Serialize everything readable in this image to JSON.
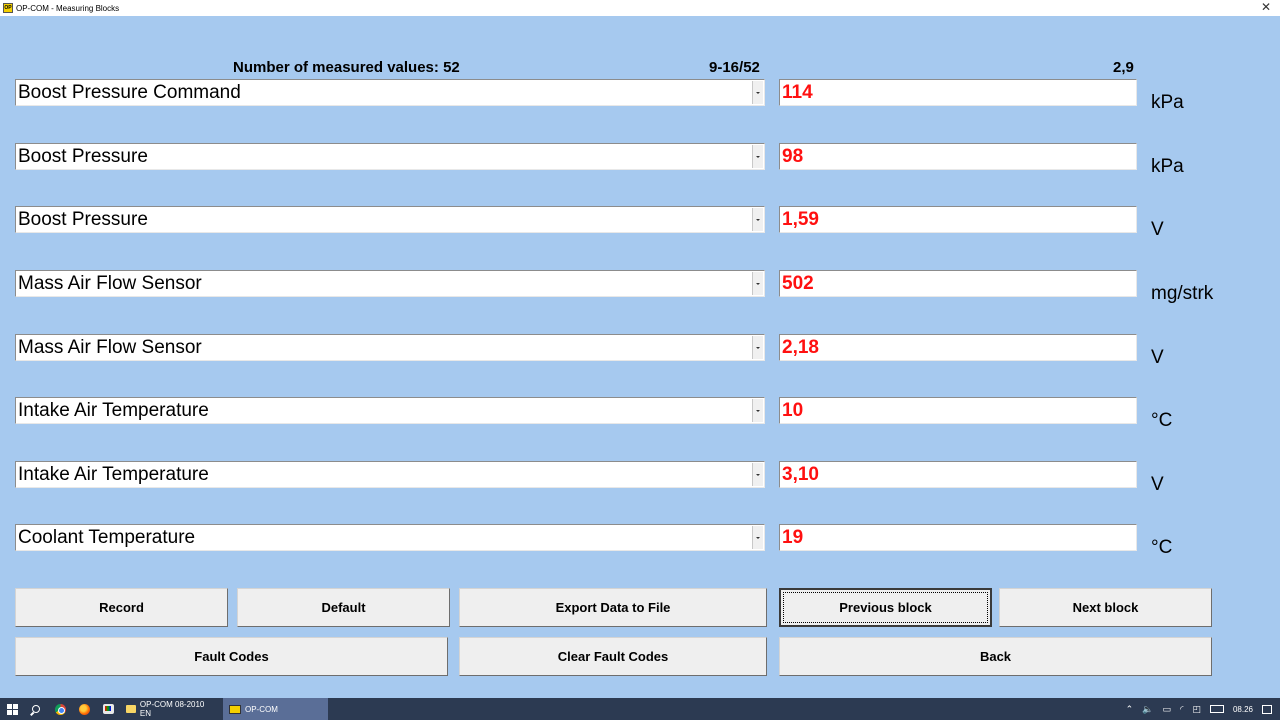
{
  "window": {
    "title": "OP-COM - Measuring Blocks",
    "icon_text": "OP COM"
  },
  "header": {
    "count_label": "Number of measured values: 52",
    "range": "9-16/52",
    "time": "2,9"
  },
  "rows": [
    {
      "name": "Boost Pressure Command",
      "value": "114",
      "unit": "kPa"
    },
    {
      "name": "Boost Pressure",
      "value": "98",
      "unit": "kPa"
    },
    {
      "name": "Boost Pressure",
      "value": "1,59",
      "unit": "V"
    },
    {
      "name": "Mass Air Flow Sensor",
      "value": "502",
      "unit": "mg/strk"
    },
    {
      "name": "Mass Air Flow Sensor",
      "value": "2,18",
      "unit": "V"
    },
    {
      "name": "Intake Air Temperature",
      "value": "10",
      "unit": "°C"
    },
    {
      "name": "Intake Air Temperature",
      "value": "3,10",
      "unit": "V"
    },
    {
      "name": "Coolant Temperature",
      "value": "19",
      "unit": "°C"
    }
  ],
  "buttons": {
    "record": "Record",
    "default": "Default",
    "export": "Export Data to File",
    "previous": "Previous block",
    "next": "Next block",
    "fault_codes": "Fault Codes",
    "clear_fault_codes": "Clear Fault Codes",
    "back": "Back"
  },
  "colors": {
    "background": "#a6c9ef",
    "value_text": "#ff1010"
  },
  "taskbar": {
    "tasks": [
      {
        "label": "OP-COM 08-2010 EN",
        "icon": "folder-icon"
      },
      {
        "label": "OP-COM",
        "icon": "opcom-icon",
        "active": true
      }
    ],
    "clock": "08.26"
  }
}
